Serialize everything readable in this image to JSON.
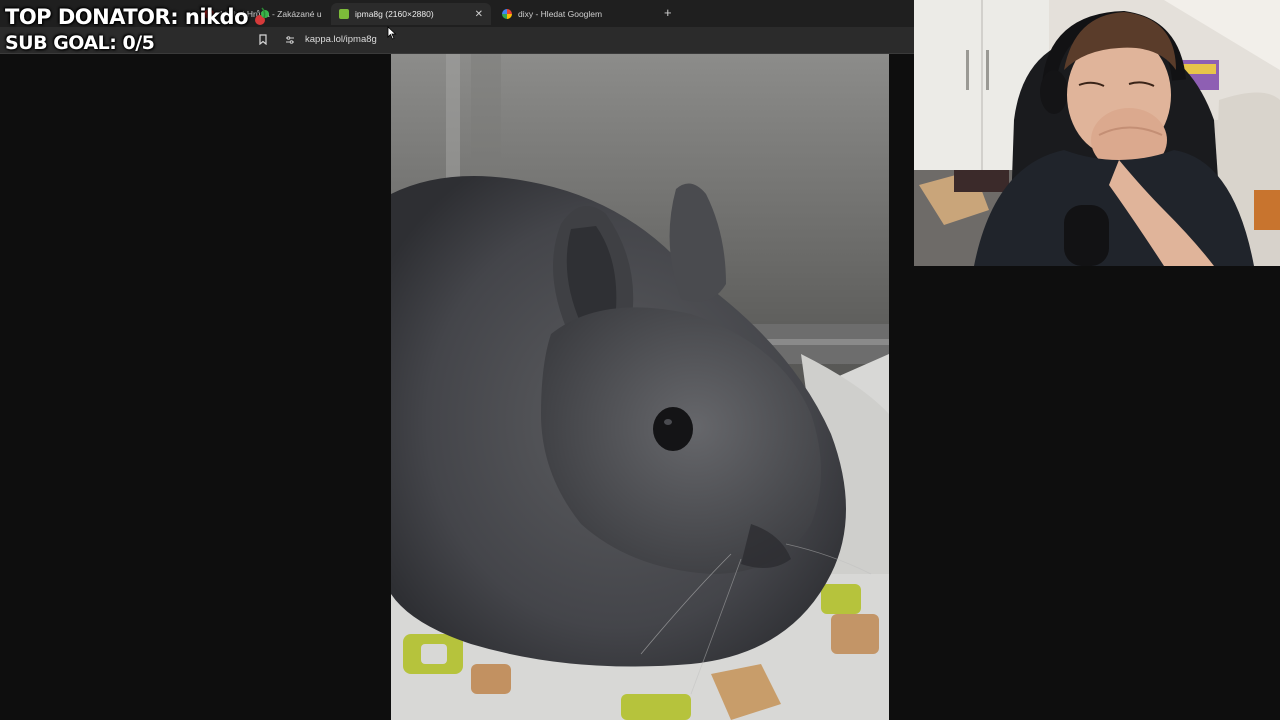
{
  "overlay": {
    "top_donator": "TOP DONATOR: nikdo",
    "sub_goal": "SUB GOAL: 0/5"
  },
  "browser": {
    "tabs": [
      {
        "label": "Michal Hrůza - Zakázané u",
        "icon": "youtube-icon",
        "active": false
      },
      {
        "label": "ipma8g (2160×2880)",
        "icon": "kappa-icon",
        "active": true
      },
      {
        "label": "dixy - Hledat Googlem",
        "icon": "google-icon",
        "active": false
      }
    ],
    "address": "kappa.lol/ipma8g",
    "new_tab_label": "+"
  },
  "colors": {
    "background": "#0e0e0e",
    "tabbar": "#1f1f1f",
    "toolbar": "#2b2b2b",
    "accent": "#e0e0e0"
  }
}
